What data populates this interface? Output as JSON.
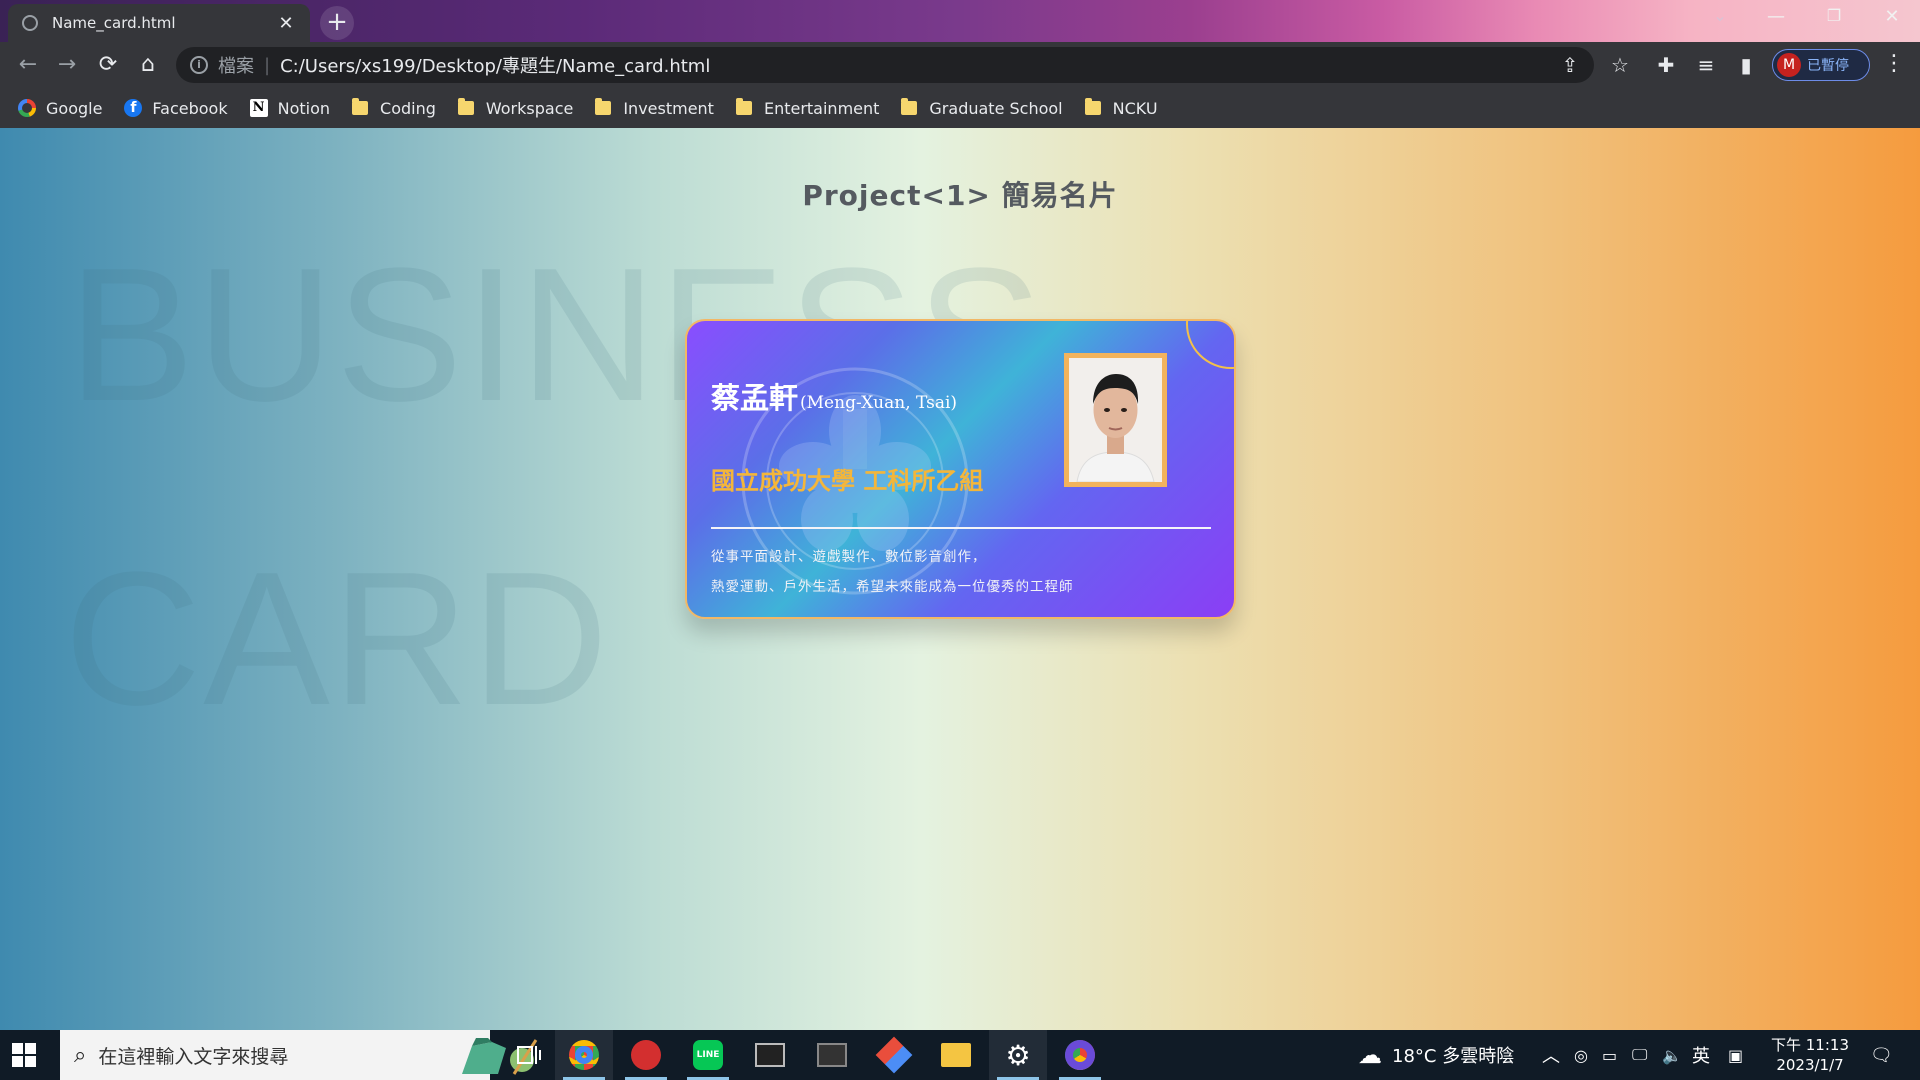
{
  "browser": {
    "tab_title": "Name_card.html",
    "url_scheme_label": "檔案",
    "url": "C:/Users/xs199/Desktop/專題生/Name_card.html",
    "profile_initial": "M",
    "profile_status": "已暫停"
  },
  "bookmarks": [
    {
      "label": "Google",
      "icon": "google-icon"
    },
    {
      "label": "Facebook",
      "icon": "facebook-icon"
    },
    {
      "label": "Notion",
      "icon": "notion-icon"
    },
    {
      "label": "Coding",
      "icon": "folder-icon"
    },
    {
      "label": "Workspace",
      "icon": "folder-icon"
    },
    {
      "label": "Investment",
      "icon": "folder-icon"
    },
    {
      "label": "Entertainment",
      "icon": "folder-icon"
    },
    {
      "label": "Graduate School",
      "icon": "folder-icon"
    },
    {
      "label": "NCKU",
      "icon": "folder-icon"
    }
  ],
  "page": {
    "title": "Project<1> 簡易名片",
    "bg_word_1": "BUSINESS",
    "bg_word_2": "CARD"
  },
  "card": {
    "name_zh": "蔡孟軒",
    "name_en": "(Meng-Xuan, Tsai)",
    "organization": "國立成功大學 工科所乙組",
    "description_line_1": "從事平面設計、遊戲製作、數位影音創作，",
    "description_line_2": "熱愛運動、戶外生活，希望未來能成為一位優秀的工程師",
    "accent_color": "#f4b63a"
  },
  "taskbar": {
    "search_placeholder": "在這裡輸入文字來搜尋",
    "weather": "18°C 多雲時陰",
    "ime": "英",
    "time": "下午 11:13",
    "date": "2023/1/7"
  }
}
